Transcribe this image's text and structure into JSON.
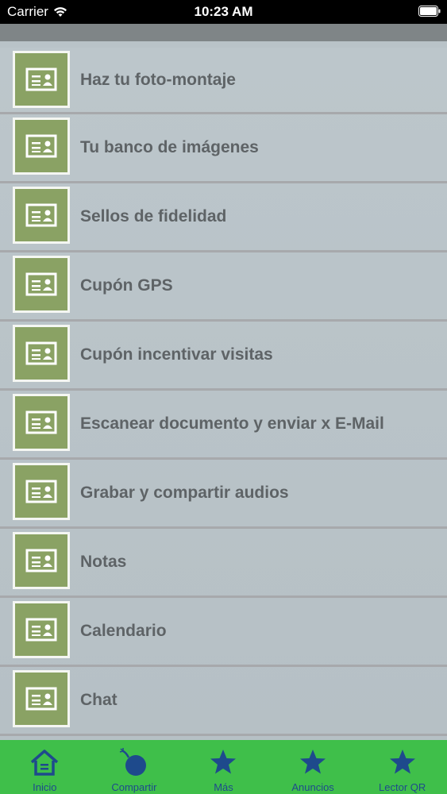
{
  "status_bar": {
    "carrier": "Carrier",
    "time": "10:23 AM"
  },
  "menu": {
    "items": [
      {
        "label": "Haz tu foto-montaje",
        "icon": "id-card-icon"
      },
      {
        "label": "Tu banco de imágenes",
        "icon": "id-card-icon"
      },
      {
        "label": "Sellos de fidelidad",
        "icon": "id-card-icon"
      },
      {
        "label": "Cupón GPS",
        "icon": "id-card-icon"
      },
      {
        "label": "Cupón incentivar visitas",
        "icon": "id-card-icon"
      },
      {
        "label": "Escanear documento y enviar x E-Mail",
        "icon": "id-card-icon"
      },
      {
        "label": "Grabar y compartir audios",
        "icon": "id-card-icon"
      },
      {
        "label": "Notas",
        "icon": "id-card-icon"
      },
      {
        "label": "Calendario",
        "icon": "id-card-icon"
      },
      {
        "label": "Chat",
        "icon": "id-card-icon"
      }
    ]
  },
  "tab_bar": {
    "tabs": [
      {
        "label": "Inicio",
        "icon": "home-icon"
      },
      {
        "label": "Compartir",
        "icon": "bomb-icon"
      },
      {
        "label": "Más",
        "icon": "star-icon"
      },
      {
        "label": "Anuncios",
        "icon": "star-icon"
      },
      {
        "label": "Lector QR",
        "icon": "star-icon"
      }
    ]
  },
  "colors": {
    "tab_bar_bg": "#3fbf4a",
    "tab_icon": "#1e4a8c",
    "thumb_bg": "#8aa264",
    "label_text": "#5e6366"
  }
}
